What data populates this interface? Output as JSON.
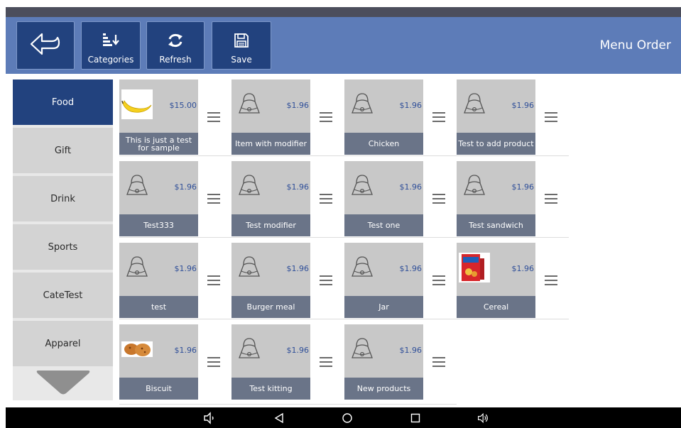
{
  "toolbar": {
    "title": "Menu Order",
    "back_icon": "back-arrow-icon",
    "categories_label": "Categories",
    "refresh_label": "Refresh",
    "save_label": "Save",
    "color": "#5d7cb8",
    "button_color": "#22427e"
  },
  "sidebar": {
    "items": [
      {
        "label": "Food",
        "active": true
      },
      {
        "label": "Gift",
        "active": false
      },
      {
        "label": "Drink",
        "active": false
      },
      {
        "label": "Sports",
        "active": false
      },
      {
        "label": "CateTest",
        "active": false
      },
      {
        "label": "Apparel",
        "active": false
      }
    ],
    "scroll_down_icon": "triangle-down-icon"
  },
  "products": [
    {
      "name": "This is just a test for sample",
      "price": "$15.00",
      "image": "banana"
    },
    {
      "name": "Item with modifier",
      "price": "$1.96",
      "image": "placeholder-bag"
    },
    {
      "name": "Chicken",
      "price": "$1.96",
      "image": "placeholder-bag"
    },
    {
      "name": "Test to add product",
      "price": "$1.96",
      "image": "placeholder-bag"
    },
    {
      "name": "Test333",
      "price": "$1.96",
      "image": "placeholder-bag"
    },
    {
      "name": "Test modifier",
      "price": "$1.96",
      "image": "placeholder-bag"
    },
    {
      "name": "Test one",
      "price": "$1.96",
      "image": "placeholder-bag"
    },
    {
      "name": "Test sandwich",
      "price": "$1.96",
      "image": "placeholder-bag"
    },
    {
      "name": "test",
      "price": "$1.96",
      "image": "placeholder-bag"
    },
    {
      "name": "Burger meal",
      "price": "$1.96",
      "image": "placeholder-bag"
    },
    {
      "name": "Jar",
      "price": "$1.96",
      "image": "placeholder-bag"
    },
    {
      "name": "Cereal",
      "price": "$1.96",
      "image": "cereal-box"
    },
    {
      "name": "Biscuit",
      "price": "$1.96",
      "image": "biscuit"
    },
    {
      "name": "Test kitting",
      "price": "$1.96",
      "image": "placeholder-bag"
    },
    {
      "name": "New products",
      "price": "$1.96",
      "image": "placeholder-bag"
    }
  ],
  "navbar": {
    "icons": [
      "volume-down-icon",
      "nav-back-icon",
      "nav-home-icon",
      "nav-recents-icon",
      "volume-up-icon"
    ]
  }
}
